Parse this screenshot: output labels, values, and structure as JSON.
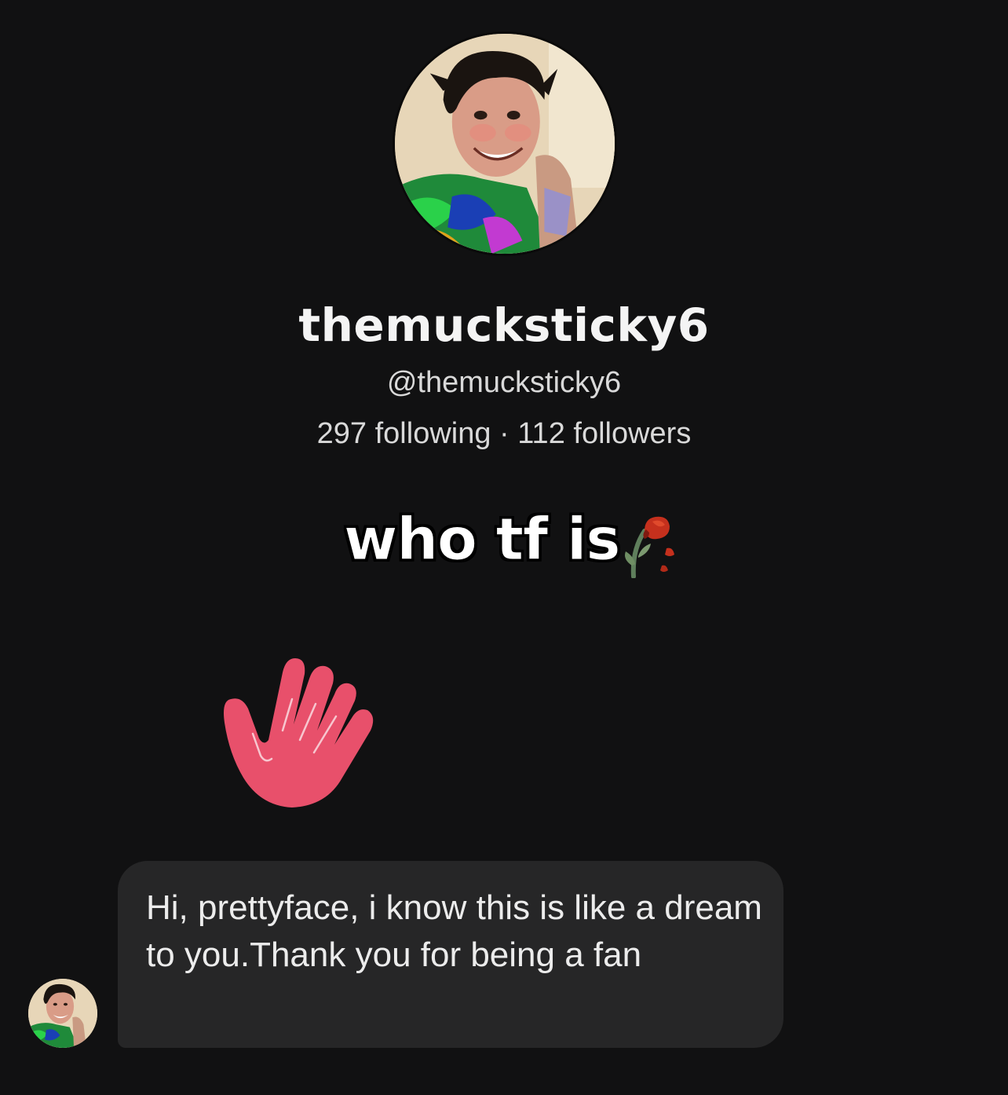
{
  "profile": {
    "display_name": "themucksticky6",
    "handle": "@themucksticky6",
    "stats": "297 following · 112 followers",
    "avatar_icon": "profile-photo"
  },
  "overlay": {
    "caption": "who tf is",
    "emoji": "wilted-rose-icon"
  },
  "sticker": {
    "icon": "waving-hand-icon",
    "color": "#e8506b"
  },
  "message": {
    "text": "Hi, prettyface, i know this is like a dream to you.Thank you for being a fan",
    "avatar_icon": "sender-avatar"
  },
  "colors": {
    "background": "#111112",
    "bubble": "#262627",
    "text": "#f2f2f2"
  }
}
